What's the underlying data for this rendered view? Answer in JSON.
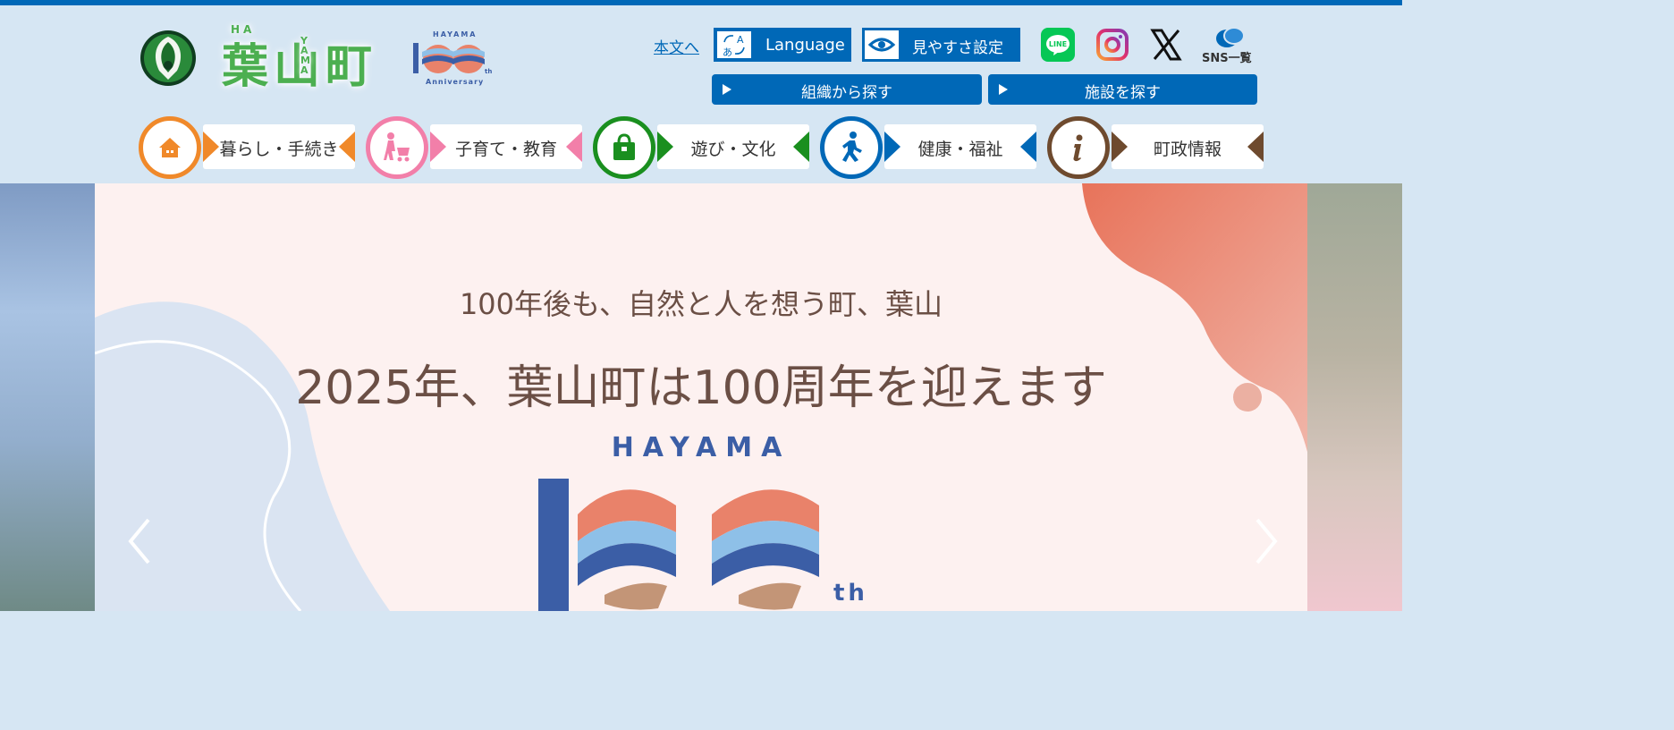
{
  "header": {
    "town_name": "葉山町",
    "town_romaji_ha": "HA",
    "town_romaji_yama": "YAMA",
    "anniv_top": "HAYAMA",
    "anniv_bottom": "Anniversary",
    "skip_link": "本文へ",
    "language_label": "Language",
    "accessibility_label": "見やすさ設定",
    "sns_list_label": "SNS一覧",
    "line_label": "LINE",
    "search_org": "組織から探す",
    "search_facility": "施設を探す"
  },
  "nav": [
    {
      "label": "暮らし・手続き",
      "icon": "house-icon",
      "color": "#f0892a"
    },
    {
      "label": "子育て・教育",
      "icon": "stroller-icon",
      "color": "#f27fa9"
    },
    {
      "label": "遊び・文化",
      "icon": "bag-icon",
      "color": "#1a8f1f"
    },
    {
      "label": "健康・福祉",
      "icon": "walking-person-icon",
      "color": "#0068b7"
    },
    {
      "label": "町政情報",
      "icon": "info-icon",
      "color": "#6e4a2e"
    }
  ],
  "hero": {
    "catch": "100年後も、自然と人を想う町、葉山",
    "headline": "2025年、葉山町は100周年を迎えます",
    "logo_top": "HAYAMA",
    "logo_suffix": "th",
    "prev": "‹",
    "next": "›"
  },
  "colors": {
    "brand": "#0068b7",
    "header_bg": "#d6e6f3",
    "town_green": "#4caf50",
    "slide_bg": "#fdf1f0",
    "hero_text": "#6b4f45"
  }
}
